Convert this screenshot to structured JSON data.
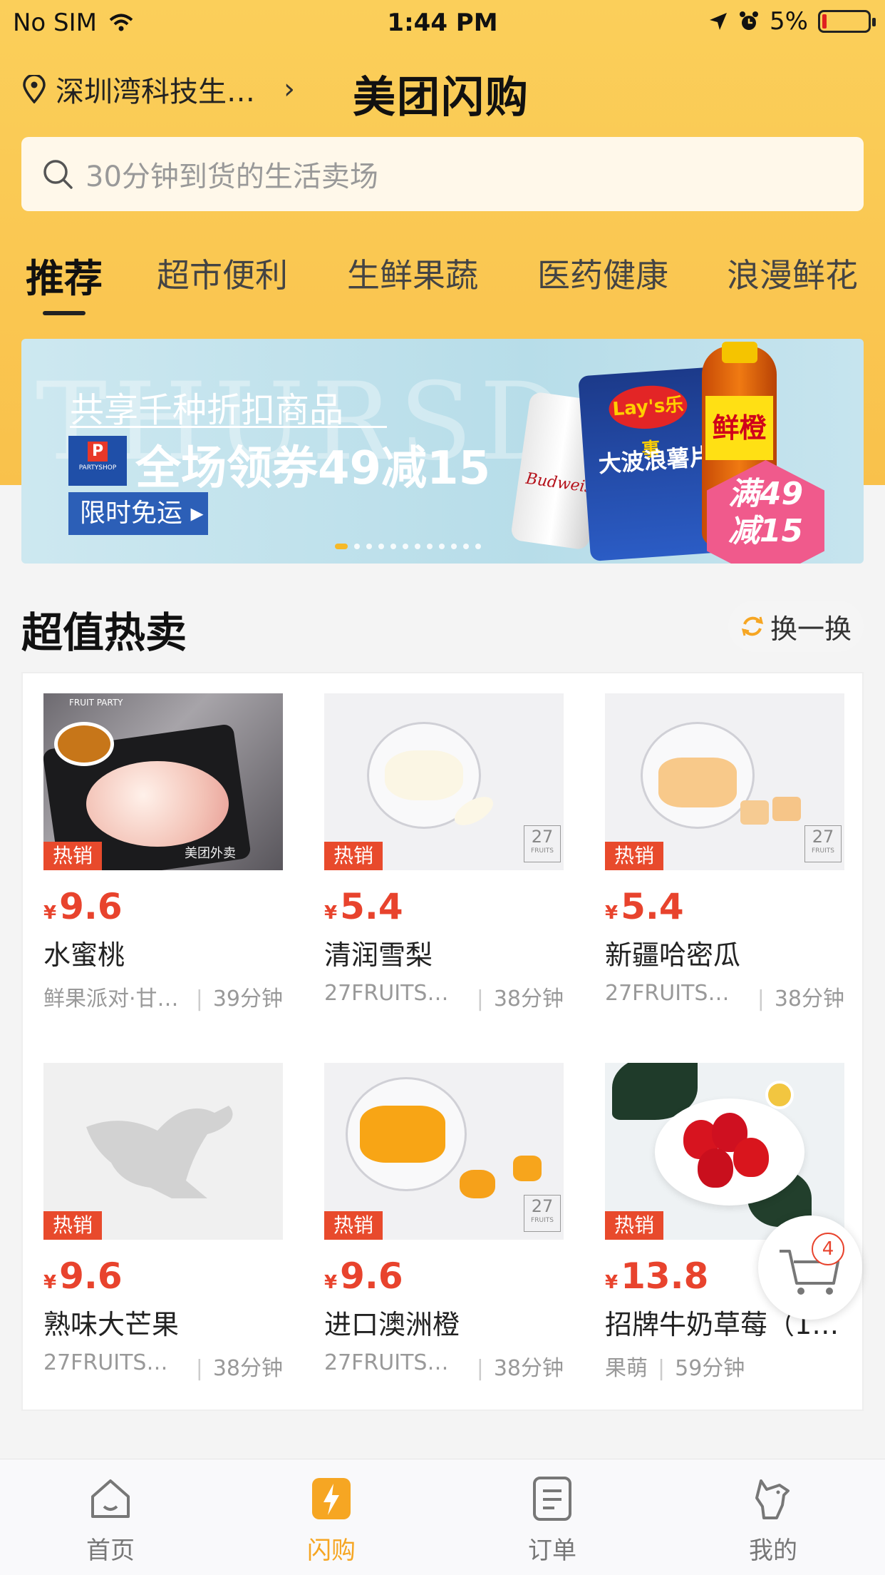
{
  "status_bar": {
    "carrier": "No SIM",
    "time": "1:44 PM",
    "battery": "5%"
  },
  "header": {
    "location": "深圳湾科技生…",
    "brand": "美团闪购"
  },
  "search": {
    "placeholder": "30分钟到货的生活卖场"
  },
  "tabs": [
    {
      "label": "推荐",
      "active": true
    },
    {
      "label": "超市便利"
    },
    {
      "label": "生鲜果蔬"
    },
    {
      "label": "医药健康"
    },
    {
      "label": "浪漫鲜花"
    }
  ],
  "banner": {
    "watermark": "THURSDAY",
    "line1": "共享千种折扣商品",
    "line2": "全场领券49减15",
    "button": "限时免运",
    "badge_line1": "满49",
    "badge_line2": "减15",
    "can_label": "Budweiser",
    "chips_brand": "Lay's乐事",
    "chips_name": "大波浪薯片",
    "bottle_label": "鲜橙",
    "logo_text": "PARTYSHOP"
  },
  "section": {
    "title": "超值热卖",
    "swap_label": "换一换"
  },
  "products": [
    {
      "hot": "热销",
      "currency": "¥",
      "price": "9.6",
      "name": "水蜜桃",
      "shop": "鲜果派对·甘…",
      "eta": "39分钟",
      "thumb": "peach"
    },
    {
      "hot": "热销",
      "currency": "¥",
      "price": "5.4",
      "name": "清润雪梨",
      "shop": "27FRUITS…",
      "eta": "38分钟",
      "thumb": "pear"
    },
    {
      "hot": "热销",
      "currency": "¥",
      "price": "5.4",
      "name": "新疆哈密瓜",
      "shop": "27FRUITS…",
      "eta": "38分钟",
      "thumb": "melon"
    },
    {
      "hot": "热销",
      "currency": "¥",
      "price": "9.6",
      "name": "熟味大芒果",
      "shop": "27FRUITS…",
      "eta": "38分钟",
      "thumb": "placeholder"
    },
    {
      "hot": "热销",
      "currency": "¥",
      "price": "9.6",
      "name": "进口澳洲橙",
      "shop": "27FRUITS…",
      "eta": "38分钟",
      "thumb": "orange"
    },
    {
      "hot": "热销",
      "currency": "¥",
      "price": "13.8",
      "name": "招牌牛奶草莓（10…",
      "shop": "果萌",
      "eta": "59分钟",
      "thumb": "strawberry"
    }
  ],
  "thumb_text": {
    "fruit_party": "FRUIT PARTY",
    "watermark_wm": "美团外卖",
    "tag_27": "27",
    "tag_fruits": "FRUITS"
  },
  "cart": {
    "count": "4"
  },
  "bottom_nav": [
    {
      "label": "首页",
      "icon": "home-icon"
    },
    {
      "label": "闪购",
      "icon": "flash-icon",
      "active": true
    },
    {
      "label": "订单",
      "icon": "order-icon"
    },
    {
      "label": "我的",
      "icon": "profile-icon"
    }
  ],
  "colors": {
    "accent": "#f6a623",
    "header": "#fbcf5a",
    "price": "#e8432d",
    "hot_tag": "#e84a2c"
  }
}
